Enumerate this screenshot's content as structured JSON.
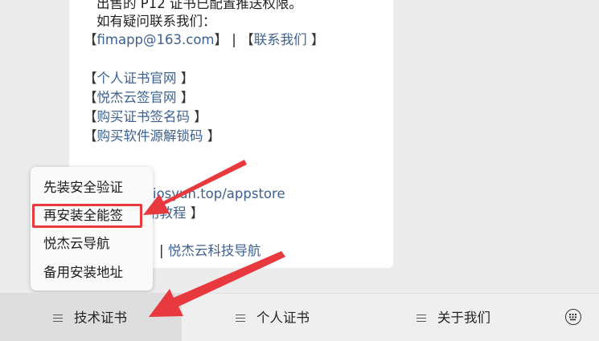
{
  "message": {
    "line_cut": "出售的 P12 证书已配置推送权限。",
    "contact_prompt": "如有疑问联系我们：",
    "email_link": "fimapp@163.com",
    "separator": " | ",
    "contact_link": "联系我们",
    "links": [
      "个人证书官网",
      "悦杰云签官网",
      "购买证书签名码",
      "购买软件源解锁码"
    ],
    "partial_colon": "：",
    "partial_url": "iosyun.top/appstore",
    "partial_tutorial": "用教程",
    "partial_nav": "悦杰云科技导航"
  },
  "popup_menu": {
    "items": [
      "先装安全验证",
      "再安装全能签",
      "悦杰云导航",
      "备用安装地址"
    ],
    "highlighted_index": 1
  },
  "tabbar": {
    "tabs": [
      {
        "label": "技术证书",
        "active": true
      },
      {
        "label": "个人证书",
        "active": false
      },
      {
        "label": "关于我们",
        "active": false
      }
    ],
    "keyboard_icon": "keyboard-icon"
  },
  "annotations": {
    "arrow_color": "#e8393e"
  },
  "colors": {
    "link": "#3e6193",
    "highlight": "#e8393e"
  }
}
